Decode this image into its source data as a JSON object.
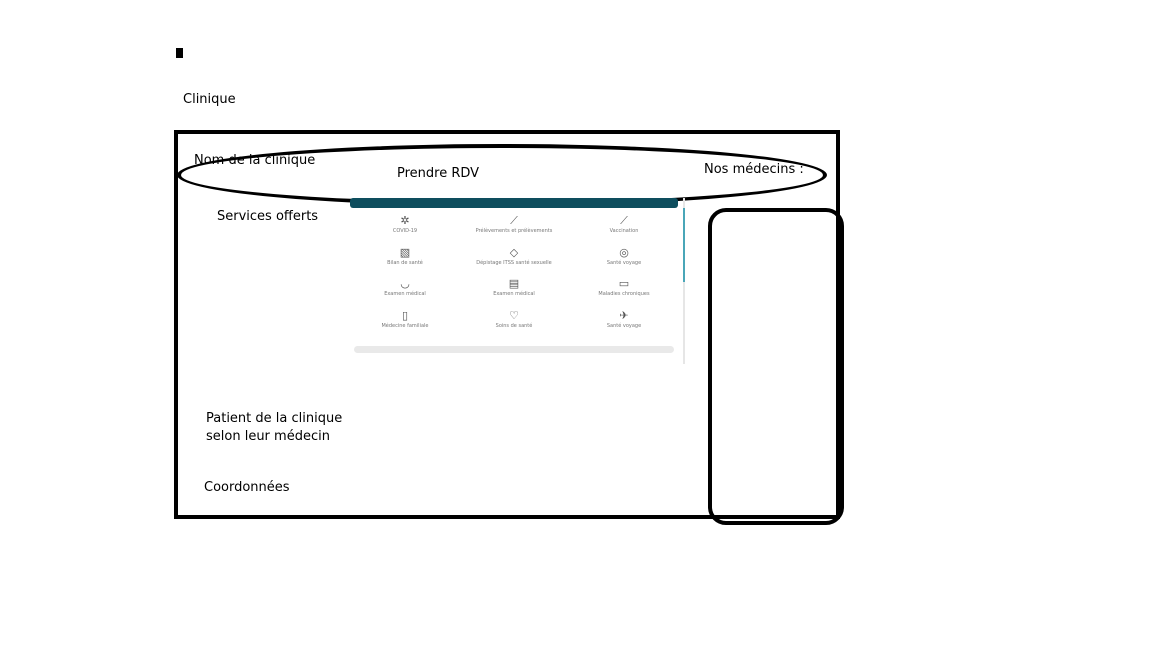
{
  "page": {
    "title": "Clinique"
  },
  "header": {
    "clinic_name": "Nom de la clinique",
    "book_appointment": "Prendre RDV",
    "our_doctors": "Nos médecins :"
  },
  "sections": {
    "services": "Services offerts",
    "patients_line1": "Patient de la clinique",
    "patients_line2": "selon leur médecin",
    "contact": "Coordonnées"
  },
  "services_widget": {
    "accent_color": "#0e4e5e",
    "items": [
      {
        "icon": "covid-icon",
        "glyph": "✲",
        "label": "COVID-19"
      },
      {
        "icon": "syringe-icon",
        "glyph": "⟋",
        "label": "Prélèvements et prélèvements"
      },
      {
        "icon": "vaccine-icon",
        "glyph": "⟋",
        "label": "Vaccination"
      },
      {
        "icon": "chart-icon",
        "glyph": "▧",
        "label": "Bilan de santé"
      },
      {
        "icon": "drop-icon",
        "glyph": "◇",
        "label": "Dépistage ITSS santé sexuelle"
      },
      {
        "icon": "globe-icon",
        "glyph": "◎",
        "label": "Santé voyage"
      },
      {
        "icon": "bed-icon",
        "glyph": "◡",
        "label": "Examen médical"
      },
      {
        "icon": "clipboard-icon",
        "glyph": "▤",
        "label": "Examen médical"
      },
      {
        "icon": "monitor-icon",
        "glyph": "▭",
        "label": "Maladies chroniques"
      },
      {
        "icon": "pill-icon",
        "glyph": "▯",
        "label": "Médecine familiale"
      },
      {
        "icon": "heart-icon",
        "glyph": "♡",
        "label": "Soins de santé"
      },
      {
        "icon": "plane-icon",
        "glyph": "✈",
        "label": "Santé voyage"
      }
    ]
  }
}
